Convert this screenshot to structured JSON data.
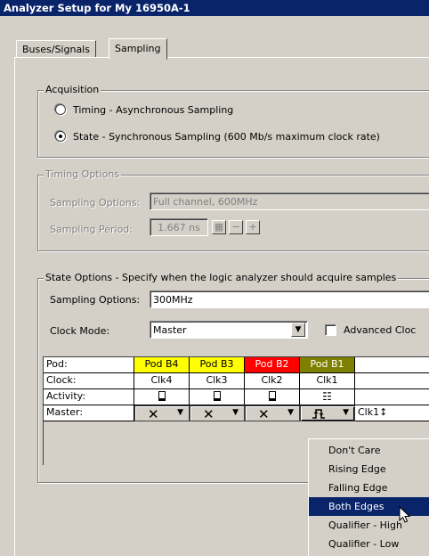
{
  "window": {
    "title": "Analyzer Setup for My 16950A-1"
  },
  "tabs": [
    {
      "label": "Buses/Signals",
      "active": false
    },
    {
      "label": "Sampling",
      "active": true
    }
  ],
  "acquisition": {
    "legend": "Acquisition",
    "options": [
      {
        "label": "Timing - Asynchronous Sampling",
        "selected": false
      },
      {
        "label": "State - Synchronous Sampling (600 Mb/s maximum clock rate)",
        "selected": true
      }
    ]
  },
  "timing_options": {
    "legend": "Timing Options",
    "sampling_options_label": "Sampling Options:",
    "sampling_options_value": "Full channel, 600MHz",
    "sampling_period_label": "Sampling Period:",
    "sampling_period_value": "1.667 ns",
    "calc_icon": "calculator-icon",
    "minus": "−",
    "plus": "+"
  },
  "state_options": {
    "legend": "State Options - Specify when the logic analyzer should acquire samples",
    "sampling_options_label": "Sampling Options:",
    "sampling_options_value": "300MHz",
    "clock_mode_label": "Clock Mode:",
    "clock_mode_value": "Master",
    "advanced_label": "Advanced Cloc"
  },
  "pod_table": {
    "row_labels": [
      "Pod:",
      "Clock:",
      "Activity:",
      "Master:"
    ],
    "pods": [
      {
        "name": "Pod B4",
        "clock": "Clk4",
        "color": "#ffff00",
        "master": "✕"
      },
      {
        "name": "Pod B3",
        "clock": "Clk3",
        "color": "#ffff00",
        "master": "✕"
      },
      {
        "name": "Pod B2",
        "clock": "Clk2",
        "color": "#ff0000",
        "master": "✕"
      },
      {
        "name": "Pod B1",
        "clock": "Clk1",
        "color": "#808000",
        "master": "both-edges-icon"
      }
    ],
    "master_summary": "Clk1↕"
  },
  "dropdown_menu": {
    "items": [
      {
        "label": "Don't Care",
        "selected": false
      },
      {
        "label": "Rising Edge",
        "selected": false
      },
      {
        "label": "Falling Edge",
        "selected": false
      },
      {
        "label": "Both Edges",
        "selected": true
      },
      {
        "label": "Qualifier - High",
        "selected": false
      },
      {
        "label": "Qualifier - Low",
        "selected": false
      }
    ]
  }
}
